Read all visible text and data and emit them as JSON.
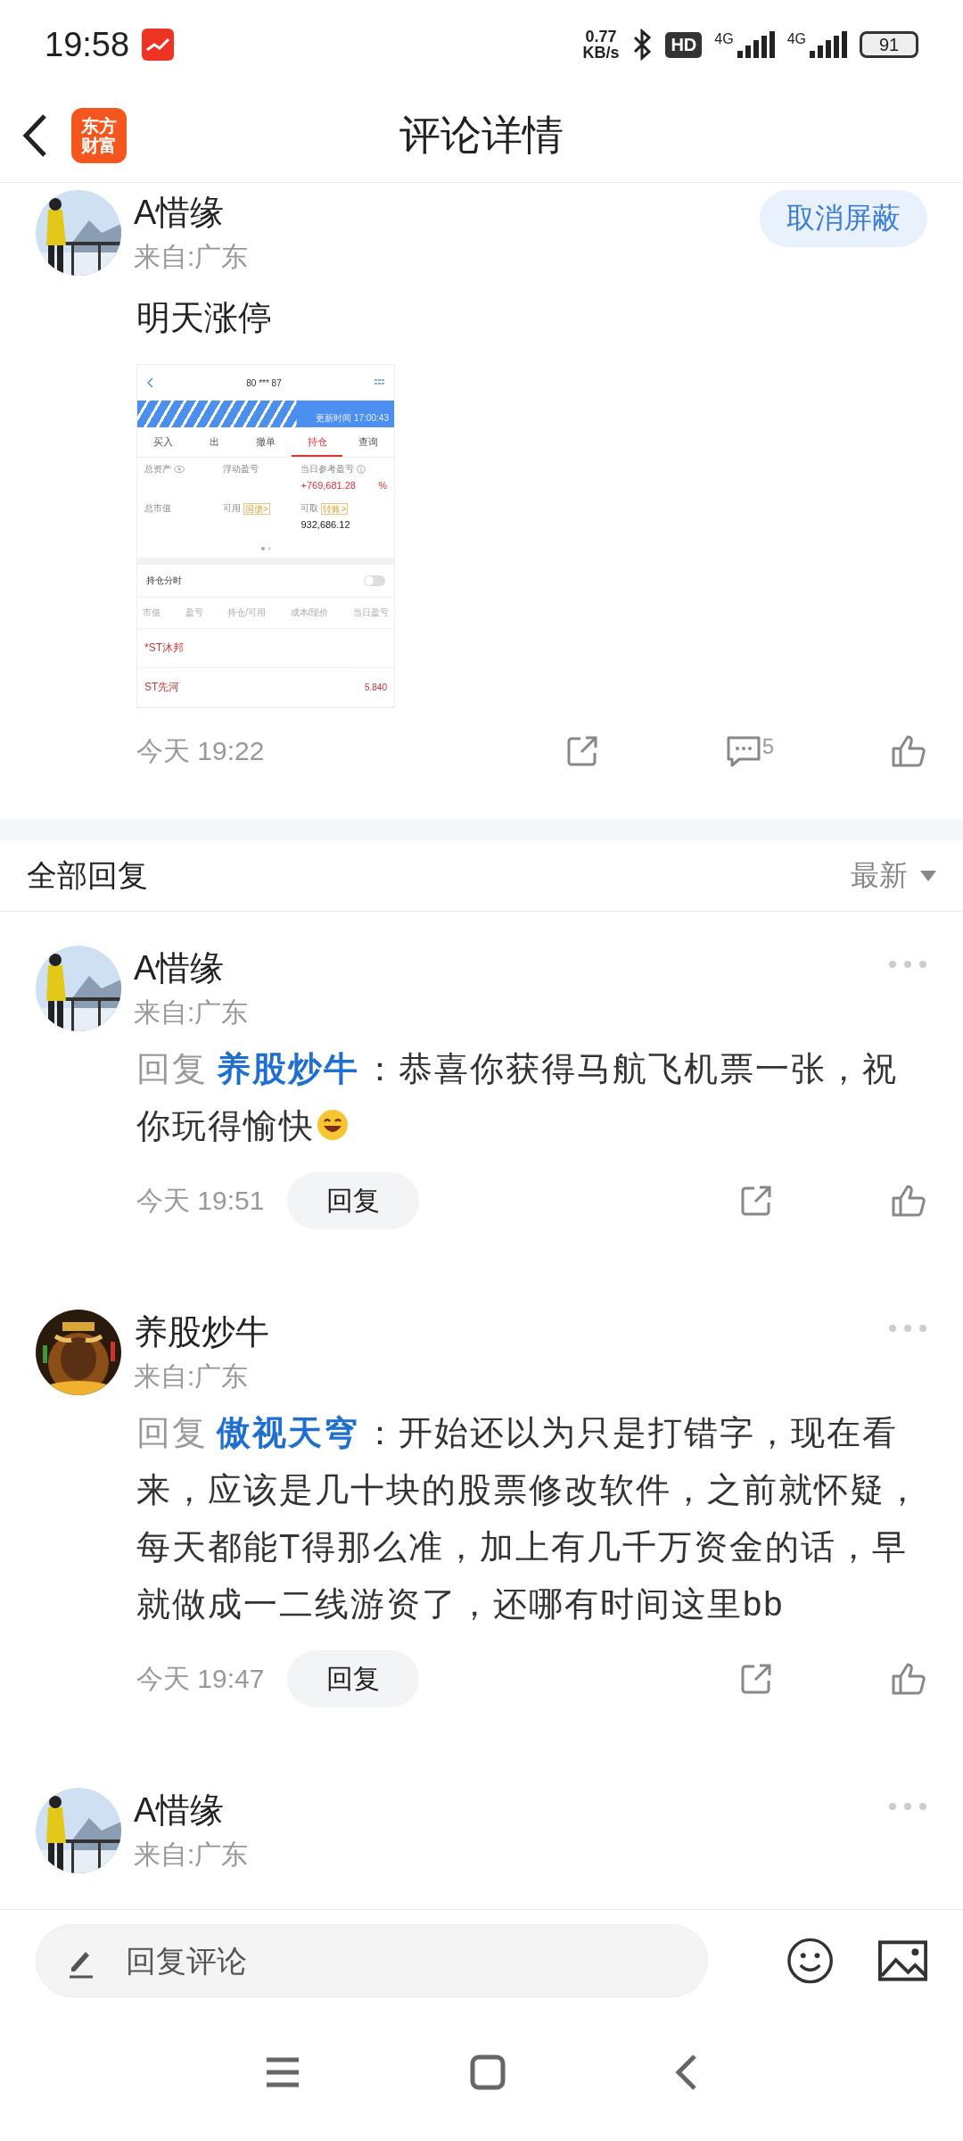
{
  "status_bar": {
    "time": "19:58",
    "speed_value": "0.77",
    "speed_unit": "KB/s",
    "hd": "HD",
    "networks": [
      "4G",
      "4G"
    ],
    "battery": "91"
  },
  "header": {
    "logo_lines": [
      "东方",
      "财富"
    ],
    "title": "评论详情"
  },
  "post": {
    "author": "A惜缘",
    "location": "来自:广东",
    "action": "取消屏蔽",
    "text": "明天涨停",
    "attachment": {
      "account": "80 *** 87",
      "update_time": "更新时间 17:00:43",
      "tabs": [
        {
          "label": "买入",
          "selected": false
        },
        {
          "label": "出",
          "selected": false
        },
        {
          "label": "撤单",
          "selected": false
        },
        {
          "label": "持仓",
          "selected": true
        },
        {
          "label": "查询",
          "selected": false
        }
      ],
      "summary": [
        {
          "label": "总资产",
          "kind": "eye"
        },
        {
          "label": "浮动盈亏",
          "kind": "plain"
        },
        {
          "label": "当日参考盈亏",
          "kind": "info",
          "value": "+769,681.28",
          "gain": true,
          "unit": "%"
        },
        {
          "label": "总市值",
          "kind": "plain"
        },
        {
          "label": "可用",
          "kind": "tag",
          "tag": "国债>"
        },
        {
          "label": "可取",
          "kind": "tag",
          "tag": "转账>",
          "value": "932,686.12",
          "gain": false
        }
      ],
      "toggle": {
        "label": "持仓分时",
        "on": false
      },
      "columns": [
        "市值",
        "盈亏",
        "持仓/可用",
        "成本/现价",
        "当日盈亏"
      ],
      "rows": [
        {
          "name": "*ST沐邦"
        },
        {
          "name": "ST先河",
          "value": "5.840"
        }
      ]
    },
    "time": "今天 19:22",
    "comment_count": "5"
  },
  "replies_header": {
    "title": "全部回复",
    "sort": "最新"
  },
  "replies": [
    {
      "author": "A惜缘",
      "location": "来自:广东",
      "prefix": "回复",
      "mention": "养股炒牛",
      "text": "：恭喜你获得马航飞机票一张，祝你玩得愉快",
      "emoji": true,
      "time": "今天 19:51",
      "button": "回复"
    },
    {
      "author": "养股炒牛",
      "location": "来自:广东",
      "prefix": "回复",
      "mention": "傲视天穹",
      "text": "：开始还以为只是打错字，现在看来，应该是几十块的股票修改软件，之前就怀疑，每天都能T得那么准，加上有几千万资金的话，早就做成一二线游资了，还哪有时间这里bb",
      "emoji": false,
      "time": "今天 19:47",
      "button": "回复"
    },
    {
      "author": "A惜缘",
      "location": "来自:广东"
    }
  ],
  "composer": {
    "placeholder": "回复评论"
  }
}
